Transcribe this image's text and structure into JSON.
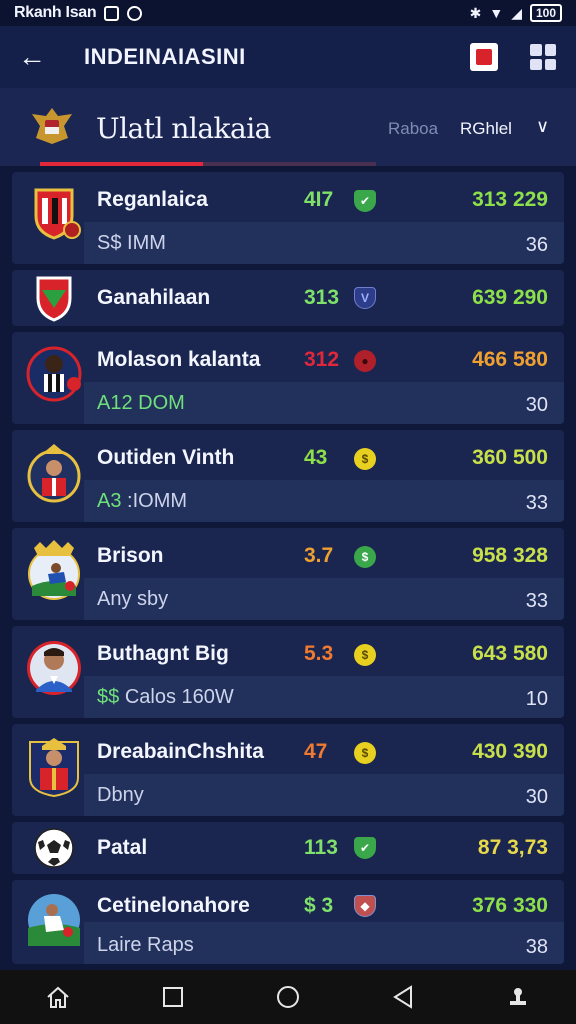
{
  "status_bar": {
    "carrier": "Rkanh Isan",
    "battery": "100"
  },
  "app_bar": {
    "title": "INDEINAIASINI"
  },
  "league": {
    "name": "Ulatl nlakaia",
    "tab_left": "Raboa",
    "tab_right": "RGhlel"
  },
  "colors": {
    "green": "#8ee04a",
    "yellow": "#e8d94a",
    "orange": "#f0a030",
    "red": "#e0283a"
  },
  "rows": [
    {
      "name": "Reganlaica",
      "sub": "S$ IMM",
      "rating": "4I7",
      "value": "313 229",
      "count": "36"
    },
    {
      "name": "Ganahilaan",
      "sub": "",
      "rating": "313",
      "value": "639 290",
      "count": ""
    },
    {
      "name": "Molason kalanta",
      "sub": "A12 DOM",
      "rating": "312",
      "value": "466 580",
      "count": "30"
    },
    {
      "name": "Outiden Vinth",
      "sub_prefix": "A3",
      "sub": ":IOMM",
      "rating": "43",
      "value": "360 500",
      "count": "33"
    },
    {
      "name": "Brison",
      "sub": "Any sby",
      "rating": "3.7",
      "value": "958 328",
      "count": "33"
    },
    {
      "name": "Buthagnt Big",
      "sub_prefix": "$$",
      "sub": "Calos 160W",
      "rating": "5.3",
      "value": "643 580",
      "count": "10"
    },
    {
      "name": "DreabainChshita",
      "sub": "Dbny",
      "rating": "47",
      "value": "430 390",
      "count": "30"
    },
    {
      "name": "Patal",
      "sub": "",
      "rating": "113",
      "value": "87 3,73",
      "count": ""
    },
    {
      "name": "Cetinelonahore",
      "sub": "Laire Raps",
      "rating": "$ 3",
      "value": "376 330",
      "count": "38"
    }
  ]
}
